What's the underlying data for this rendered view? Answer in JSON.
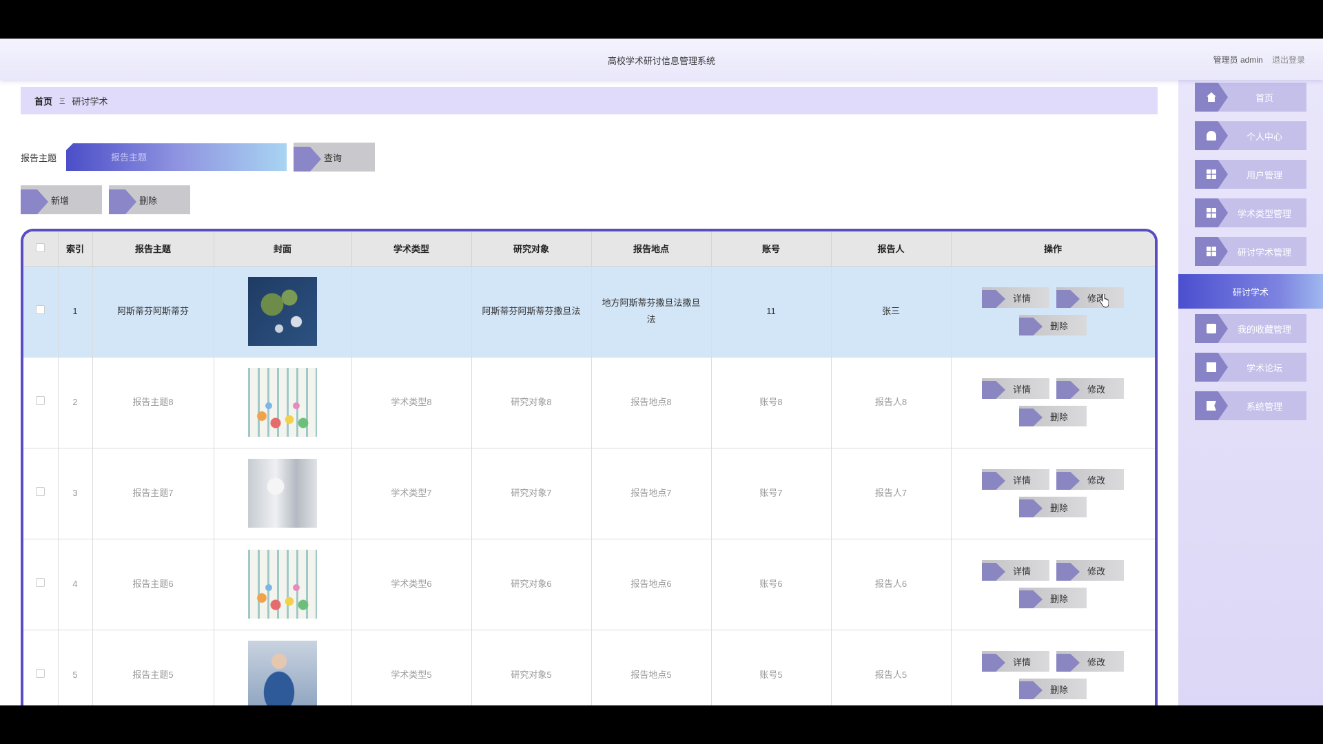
{
  "header": {
    "title": "高校学术研讨信息管理系统",
    "role_user": "管理员 admin",
    "logout": "退出登录"
  },
  "breadcrumb": {
    "home": "首页",
    "separator": "Ξ",
    "current": "研讨学术"
  },
  "search": {
    "label": "报告主题",
    "placeholder": "报告主题",
    "query_button": "查询"
  },
  "actions": {
    "add": "新增",
    "delete": "删除"
  },
  "table": {
    "columns": [
      "",
      "索引",
      "报告主题",
      "封面",
      "学术类型",
      "研究对象",
      "报告地点",
      "账号",
      "报告人",
      "操作"
    ],
    "op_labels": {
      "detail": "详情",
      "edit": "修改",
      "delete": "删除"
    },
    "rows": [
      {
        "index": "1",
        "topic": "阿斯蒂芬阿斯蒂芬",
        "cover": "satellite-map",
        "type": "",
        "object": "阿斯蒂芬阿斯蒂芬撒旦法",
        "place": "地方阿斯蒂芬撒旦法撒旦法",
        "account": "11",
        "reporter": "张三"
      },
      {
        "index": "2",
        "topic": "报告主题8",
        "cover": "confetti",
        "type": "学术类型8",
        "object": "研究对象8",
        "place": "报告地点8",
        "account": "账号8",
        "reporter": "报告人8"
      },
      {
        "index": "3",
        "topic": "报告主题7",
        "cover": "lab",
        "type": "学术类型7",
        "object": "研究对象7",
        "place": "报告地点7",
        "account": "账号7",
        "reporter": "报告人7"
      },
      {
        "index": "4",
        "topic": "报告主题6",
        "cover": "confetti",
        "type": "学术类型6",
        "object": "研究对象6",
        "place": "报告地点6",
        "account": "账号6",
        "reporter": "报告人6"
      },
      {
        "index": "5",
        "topic": "报告主题5",
        "cover": "lab-person",
        "type": "学术类型5",
        "object": "研究对象5",
        "place": "报告地点5",
        "account": "账号5",
        "reporter": "报告人5"
      }
    ]
  },
  "sidebar": {
    "items": [
      {
        "label": "首页",
        "icon": "home-icon"
      },
      {
        "label": "个人中心",
        "icon": "user-icon"
      },
      {
        "label": "用户管理",
        "icon": "grid-icon"
      },
      {
        "label": "学术类型管理",
        "icon": "grid-icon"
      },
      {
        "label": "研讨学术管理",
        "icon": "grid-icon"
      },
      {
        "label": "研讨学术",
        "icon": "",
        "active": true
      },
      {
        "label": "我的收藏管理",
        "icon": "clipboard-icon"
      },
      {
        "label": "学术论坛",
        "icon": "doc-x-icon"
      },
      {
        "label": "系统管理",
        "icon": "flag-icon"
      }
    ]
  },
  "colors": {
    "accent": "#5a4dc1",
    "header_bg": "#efedfc",
    "selected_row": "#d3e6f8",
    "nav_bg": "#e2ddf8"
  }
}
